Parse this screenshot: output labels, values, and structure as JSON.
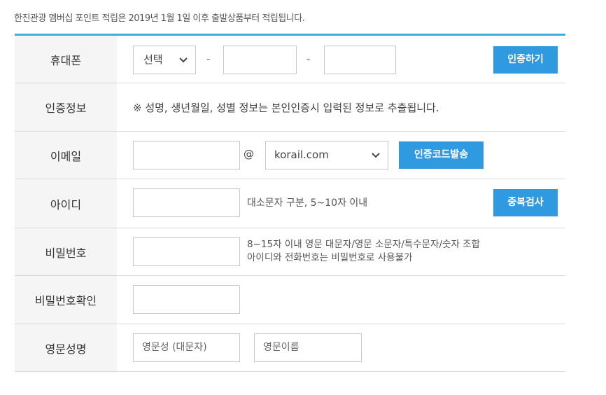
{
  "notice": "한진관광 멤버십 포인트 적립은 2019년 1월 1일 이후 출발상품부터 적립됩니다.",
  "phone": {
    "label": "휴대폰",
    "select_value": "선택",
    "dash": "-",
    "verify_button": "인증하기"
  },
  "auth_info": {
    "label": "인증정보",
    "text": "※ 성명, 생년월일, 성별 정보는 본인인증시 입력된 정보로 추출됩니다."
  },
  "email": {
    "label": "이메일",
    "at": "@",
    "domain_value": "korail.com",
    "send_code_button": "인증코드발송"
  },
  "user_id": {
    "label": "아이디",
    "hint": "대소문자 구분, 5~10자 이내",
    "check_button": "중복검사"
  },
  "password": {
    "label": "비밀번호",
    "hint_line1": "8~15자 이내 영문 대문자/영문 소문자/특수문자/숫자 조합",
    "hint_line2": "아이디와 전화번호는 비밀번호로 사용불가"
  },
  "password_confirm": {
    "label": "비밀번호확인"
  },
  "english_name": {
    "label": "영문성명",
    "last_placeholder": "영문성 (대문자)",
    "first_placeholder": "영문이름"
  },
  "icons": {
    "dropdown": "chevron-down-icon"
  }
}
